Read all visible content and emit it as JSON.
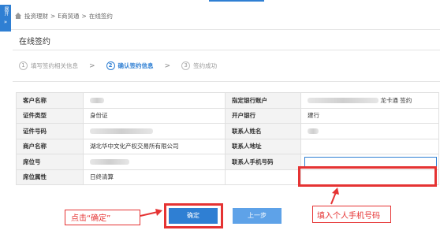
{
  "sidebar": {
    "expand_label": "展开"
  },
  "breadcrumb": [
    "投资理财",
    "E商贸通",
    "在线签约"
  ],
  "page_title": "在线签约",
  "steps": [
    {
      "num": "1",
      "label": "填写签约相关信息",
      "active": false
    },
    {
      "num": "2",
      "label": "确认签约信息",
      "active": true
    },
    {
      "num": "3",
      "label": "签约成功",
      "active": false
    }
  ],
  "table": {
    "rows": [
      {
        "l1": "客户名称",
        "v1": "",
        "l2": "指定银行账户",
        "v2": "龙卡通 签约"
      },
      {
        "l1": "证件类型",
        "v1": "身份证",
        "l2": "开户银行",
        "v2": "建行"
      },
      {
        "l1": "证件号码",
        "v1": "",
        "l2": "联系人姓名",
        "v2": ""
      },
      {
        "l1": "商户名称",
        "v1": "湖北华中文化产权交易所有限公司",
        "l2": "联系人地址",
        "v2": ""
      },
      {
        "l1": "席位号",
        "v1": "",
        "l2": "联系人手机号码",
        "v2": ""
      },
      {
        "l1": "席位属性",
        "v1": "日终清算",
        "l2": "",
        "v2": ""
      }
    ]
  },
  "buttons": {
    "confirm": "确定",
    "prev": "上一步"
  },
  "annotations": {
    "click_confirm": "点击“确定”",
    "fill_phone": "填入个人手机号码"
  },
  "colors": {
    "primary": "#2f7fd3",
    "annotation_red": "#e53333"
  }
}
